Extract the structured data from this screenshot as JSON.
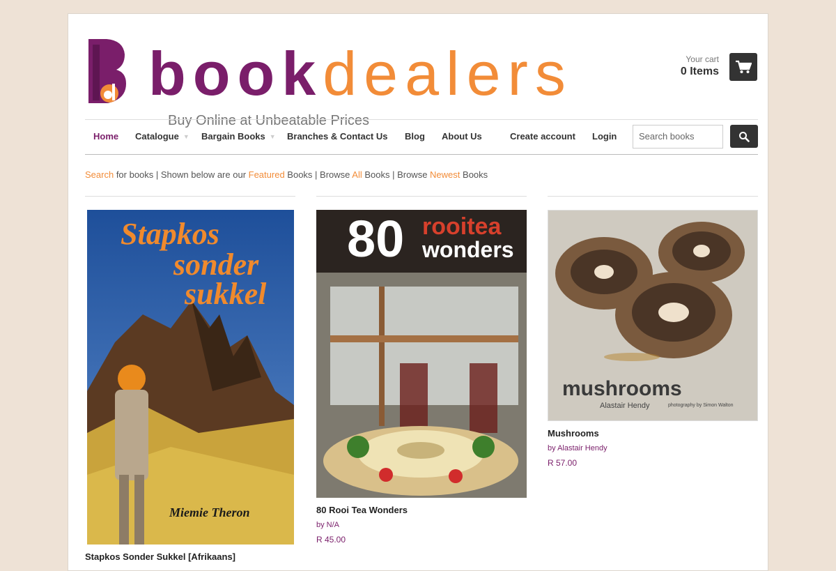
{
  "brand": {
    "name_part1": "book",
    "name_part2": "dealers",
    "tagline": "Buy Online at Unbeatable Prices",
    "colors": {
      "purple": "#7a1e6a",
      "orange": "#f28c38"
    }
  },
  "cart": {
    "label": "Your cart",
    "count": "0 Items",
    "icon": "cart-icon"
  },
  "nav": {
    "items": [
      {
        "label": "Home",
        "active": true
      },
      {
        "label": "Catalogue",
        "dropdown": true
      },
      {
        "label": "Bargain Books",
        "dropdown": true
      },
      {
        "label": "Branches & Contact Us"
      },
      {
        "label": "Blog"
      },
      {
        "label": "About Us"
      },
      {
        "label": "Create account"
      },
      {
        "label": "Login"
      }
    ],
    "search_placeholder": "Search books",
    "search_icon": "magnifier-icon"
  },
  "crumb": {
    "search": "Search",
    "t1": " for books | Shown below are our ",
    "featured": "Featured",
    "t2": " Books | Browse ",
    "all": "All",
    "t3": " Books | Browse ",
    "newest": "Newest",
    "t4": " Books"
  },
  "products": [
    {
      "title": "Stapkos Sonder Sukkel [Afrikaans]",
      "cover_text_1": "Stapkos",
      "cover_text_2": "sonder",
      "cover_text_3": "sukkel",
      "cover_author": "Miemie Theron"
    },
    {
      "title": "80 Rooi Tea Wonders",
      "author": "by N/A",
      "price": "R 45.00",
      "cover_text_1": "80",
      "cover_text_2": "rooitea",
      "cover_text_3": "wonders"
    },
    {
      "title": "Mushrooms",
      "author": "by Alastair Hendy",
      "price": "R 57.00",
      "cover_text_1": "mushrooms",
      "cover_text_2": "Alastair Hendy",
      "cover_text_3": "photography by Simon Walton"
    }
  ]
}
